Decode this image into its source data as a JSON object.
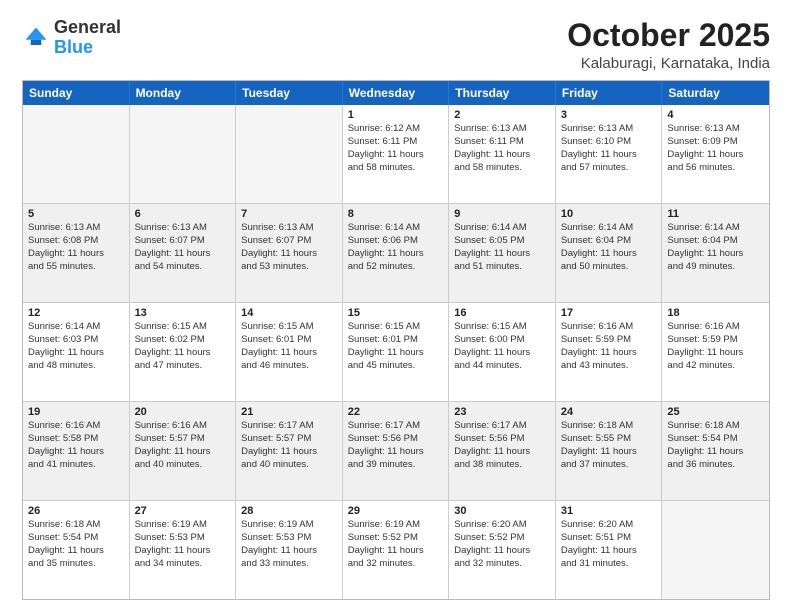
{
  "logo": {
    "general": "General",
    "blue": "Blue"
  },
  "header": {
    "month": "October 2025",
    "location": "Kalaburagi, Karnataka, India"
  },
  "days_of_week": [
    "Sunday",
    "Monday",
    "Tuesday",
    "Wednesday",
    "Thursday",
    "Friday",
    "Saturday"
  ],
  "rows": [
    [
      {
        "day": "",
        "info": "",
        "empty": true
      },
      {
        "day": "",
        "info": "",
        "empty": true
      },
      {
        "day": "",
        "info": "",
        "empty": true
      },
      {
        "day": "1",
        "info": "Sunrise: 6:12 AM\nSunset: 6:11 PM\nDaylight: 11 hours\nand 58 minutes."
      },
      {
        "day": "2",
        "info": "Sunrise: 6:13 AM\nSunset: 6:11 PM\nDaylight: 11 hours\nand 58 minutes."
      },
      {
        "day": "3",
        "info": "Sunrise: 6:13 AM\nSunset: 6:10 PM\nDaylight: 11 hours\nand 57 minutes."
      },
      {
        "day": "4",
        "info": "Sunrise: 6:13 AM\nSunset: 6:09 PM\nDaylight: 11 hours\nand 56 minutes."
      }
    ],
    [
      {
        "day": "5",
        "info": "Sunrise: 6:13 AM\nSunset: 6:08 PM\nDaylight: 11 hours\nand 55 minutes.",
        "shaded": true
      },
      {
        "day": "6",
        "info": "Sunrise: 6:13 AM\nSunset: 6:07 PM\nDaylight: 11 hours\nand 54 minutes.",
        "shaded": true
      },
      {
        "day": "7",
        "info": "Sunrise: 6:13 AM\nSunset: 6:07 PM\nDaylight: 11 hours\nand 53 minutes.",
        "shaded": true
      },
      {
        "day": "8",
        "info": "Sunrise: 6:14 AM\nSunset: 6:06 PM\nDaylight: 11 hours\nand 52 minutes.",
        "shaded": true
      },
      {
        "day": "9",
        "info": "Sunrise: 6:14 AM\nSunset: 6:05 PM\nDaylight: 11 hours\nand 51 minutes.",
        "shaded": true
      },
      {
        "day": "10",
        "info": "Sunrise: 6:14 AM\nSunset: 6:04 PM\nDaylight: 11 hours\nand 50 minutes.",
        "shaded": true
      },
      {
        "day": "11",
        "info": "Sunrise: 6:14 AM\nSunset: 6:04 PM\nDaylight: 11 hours\nand 49 minutes.",
        "shaded": true
      }
    ],
    [
      {
        "day": "12",
        "info": "Sunrise: 6:14 AM\nSunset: 6:03 PM\nDaylight: 11 hours\nand 48 minutes."
      },
      {
        "day": "13",
        "info": "Sunrise: 6:15 AM\nSunset: 6:02 PM\nDaylight: 11 hours\nand 47 minutes."
      },
      {
        "day": "14",
        "info": "Sunrise: 6:15 AM\nSunset: 6:01 PM\nDaylight: 11 hours\nand 46 minutes."
      },
      {
        "day": "15",
        "info": "Sunrise: 6:15 AM\nSunset: 6:01 PM\nDaylight: 11 hours\nand 45 minutes."
      },
      {
        "day": "16",
        "info": "Sunrise: 6:15 AM\nSunset: 6:00 PM\nDaylight: 11 hours\nand 44 minutes."
      },
      {
        "day": "17",
        "info": "Sunrise: 6:16 AM\nSunset: 5:59 PM\nDaylight: 11 hours\nand 43 minutes."
      },
      {
        "day": "18",
        "info": "Sunrise: 6:16 AM\nSunset: 5:59 PM\nDaylight: 11 hours\nand 42 minutes."
      }
    ],
    [
      {
        "day": "19",
        "info": "Sunrise: 6:16 AM\nSunset: 5:58 PM\nDaylight: 11 hours\nand 41 minutes.",
        "shaded": true
      },
      {
        "day": "20",
        "info": "Sunrise: 6:16 AM\nSunset: 5:57 PM\nDaylight: 11 hours\nand 40 minutes.",
        "shaded": true
      },
      {
        "day": "21",
        "info": "Sunrise: 6:17 AM\nSunset: 5:57 PM\nDaylight: 11 hours\nand 40 minutes.",
        "shaded": true
      },
      {
        "day": "22",
        "info": "Sunrise: 6:17 AM\nSunset: 5:56 PM\nDaylight: 11 hours\nand 39 minutes.",
        "shaded": true
      },
      {
        "day": "23",
        "info": "Sunrise: 6:17 AM\nSunset: 5:56 PM\nDaylight: 11 hours\nand 38 minutes.",
        "shaded": true
      },
      {
        "day": "24",
        "info": "Sunrise: 6:18 AM\nSunset: 5:55 PM\nDaylight: 11 hours\nand 37 minutes.",
        "shaded": true
      },
      {
        "day": "25",
        "info": "Sunrise: 6:18 AM\nSunset: 5:54 PM\nDaylight: 11 hours\nand 36 minutes.",
        "shaded": true
      }
    ],
    [
      {
        "day": "26",
        "info": "Sunrise: 6:18 AM\nSunset: 5:54 PM\nDaylight: 11 hours\nand 35 minutes."
      },
      {
        "day": "27",
        "info": "Sunrise: 6:19 AM\nSunset: 5:53 PM\nDaylight: 11 hours\nand 34 minutes."
      },
      {
        "day": "28",
        "info": "Sunrise: 6:19 AM\nSunset: 5:53 PM\nDaylight: 11 hours\nand 33 minutes."
      },
      {
        "day": "29",
        "info": "Sunrise: 6:19 AM\nSunset: 5:52 PM\nDaylight: 11 hours\nand 32 minutes."
      },
      {
        "day": "30",
        "info": "Sunrise: 6:20 AM\nSunset: 5:52 PM\nDaylight: 11 hours\nand 32 minutes."
      },
      {
        "day": "31",
        "info": "Sunrise: 6:20 AM\nSunset: 5:51 PM\nDaylight: 11 hours\nand 31 minutes."
      },
      {
        "day": "",
        "info": "",
        "empty": true
      }
    ]
  ]
}
